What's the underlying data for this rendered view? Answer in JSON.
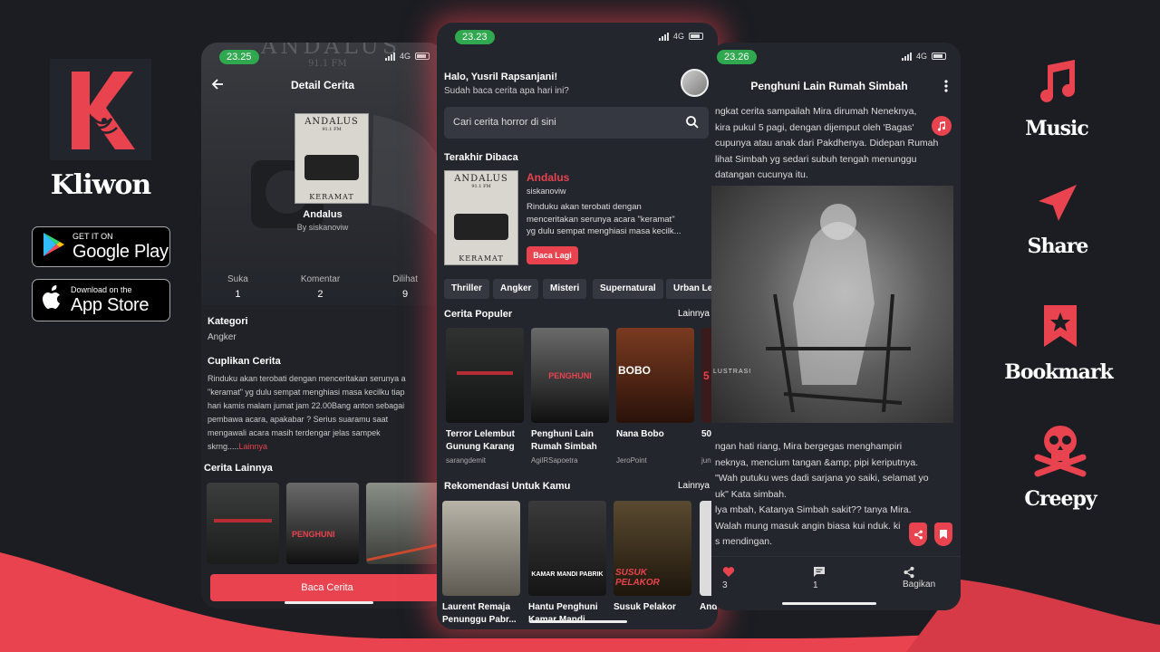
{
  "brand": {
    "name": "Kliwon"
  },
  "stores": [
    {
      "small": "GET IT ON",
      "big": "Google Play",
      "icon": "google-play-icon"
    },
    {
      "small": "Download on the",
      "big": "App Store",
      "icon": "apple-icon"
    }
  ],
  "features": [
    {
      "label": "Music",
      "icon": "music-note-icon"
    },
    {
      "label": "Share",
      "icon": "paper-plane-icon"
    },
    {
      "label": "Bookmark",
      "icon": "bookmark-star-icon"
    },
    {
      "label": "Creepy",
      "icon": "skull-crossbones-icon"
    }
  ],
  "colors": {
    "accent": "#e8434f",
    "bg": "#1b1d22",
    "card": "#23262c",
    "status_pill": "#2fa84f"
  },
  "left": {
    "time": "23.25",
    "net": "4G",
    "header_title": "Detail Cerita",
    "cover_title": "ANDALUS",
    "cover_freq": "91.1 FM",
    "cover_bottom": "KERAMAT",
    "book_title": "Andalus",
    "book_author": "By siskanoviw",
    "stats": [
      {
        "label": "Suka",
        "value": "1"
      },
      {
        "label": "Komentar",
        "value": "2"
      },
      {
        "label": "Dilihat",
        "value": "9"
      }
    ],
    "kategori_title": "Kategori",
    "kategori_value": "Angker",
    "cuplikan_title": "Cuplikan Cerita",
    "cuplikan_lines": [
      "Rinduku akan terobati dengan menceritakan serunya a",
      "\"keramat\" yg dulu sempat menghiasi masa kecilku tiap",
      "hari kamis malam jumat jam 22.00Bang anton sebagai",
      "pembawa acara, apakabar ? Serius suaramu saat",
      "mengawali acara masih terdengar jelas sampek"
    ],
    "cuplikan_tail": "skrng.....",
    "cuplikan_more": "Lainnya",
    "lainnya_title": "Cerita Lainnya",
    "cta": "Baca Cerita"
  },
  "center": {
    "time": "23.23",
    "net": "4G",
    "greeting": "Halo, Yusril Rapsanjani!",
    "sub_greeting": "Sudah baca cerita apa hari ini?",
    "search_placeholder": "Cari cerita horror di sini",
    "last_read_title": "Terakhir Dibaca",
    "last_read": {
      "cover_title": "ANDALUS",
      "cover_freq": "91.1 FM",
      "cover_bottom": "KERAMAT",
      "title": "Andalus",
      "author": "siskanoviw",
      "excerpt_lines": [
        "Rinduku akan terobati dengan",
        "menceritakan serunya acara \"keramat\"",
        "yg dulu sempat menghiasi masa kecilk..."
      ],
      "button": "Baca Lagi"
    },
    "chips": [
      "Thriller",
      "Angker",
      "Misteri",
      "Supernatural",
      "Urban Leg"
    ],
    "popular_title": "Cerita Populer",
    "popular_more": "Lainnya",
    "popular": [
      {
        "title1": "Terror Lelembut",
        "title2": "Gunung Karang",
        "author": "sarangdemit",
        "cover_text": ""
      },
      {
        "title1": "Penghuni Lain",
        "title2": "Rumah Simbah",
        "author": "AgilRSapoetra",
        "cover_text": "PENGHUNI"
      },
      {
        "title1": "Nana Bobo",
        "title2": "",
        "author": "JeroPoint",
        "cover_text": "BOBO"
      },
      {
        "title1": "50",
        "title2": "",
        "author": "junc",
        "cover_text": "5"
      }
    ],
    "reco_title": "Rekomendasi Untuk Kamu",
    "reco_more": "Lainnya",
    "reco": [
      {
        "title1": "Laurent Remaja",
        "title2": "Penunggu Pabr...",
        "cover_text": ""
      },
      {
        "title1": "Hantu Penghuni",
        "title2": "Kamar Mandi...",
        "cover_text": "KAMAR MANDI PABRIK"
      },
      {
        "title1": "Susuk Pelakor",
        "title2": "",
        "cover_text": "SUSUK PELAKOR"
      },
      {
        "title1": "And",
        "title2": "",
        "cover_text": ""
      }
    ]
  },
  "right": {
    "time": "23.26",
    "net": "4G",
    "header_title": "Penghuni Lain Rumah Simbah",
    "story_top": [
      "ngkat cerita sampailah Mira dirumah Neneknya,",
      "kira pukul 5 pagi, dengan dijemput oleh 'Bagas'",
      "cupunya atau anak dari Pakdhenya. Didepan Rumah",
      "lihat  Simbah yg sedari subuh tengah menunggu",
      "datangan cucunya itu."
    ],
    "image_caption": "LUSTRASI",
    "story_bottom": [
      "ngan hati riang, Mira bergegas menghampiri",
      "neknya, mencium tangan &amp; pipi keriputnya.",
      "  \"Wah putuku wes dadi sarjana yo saiki, selamat yo",
      "uk\" Kata simbah.",
      "lya mbah, Katanya Simbah sakit?? tanya Mira.",
      "  Walah mung masuk angin biasa kui nduk.    ki",
      "s mendingan."
    ],
    "likes": "3",
    "comments": "1",
    "share_label": "Bagikan"
  }
}
